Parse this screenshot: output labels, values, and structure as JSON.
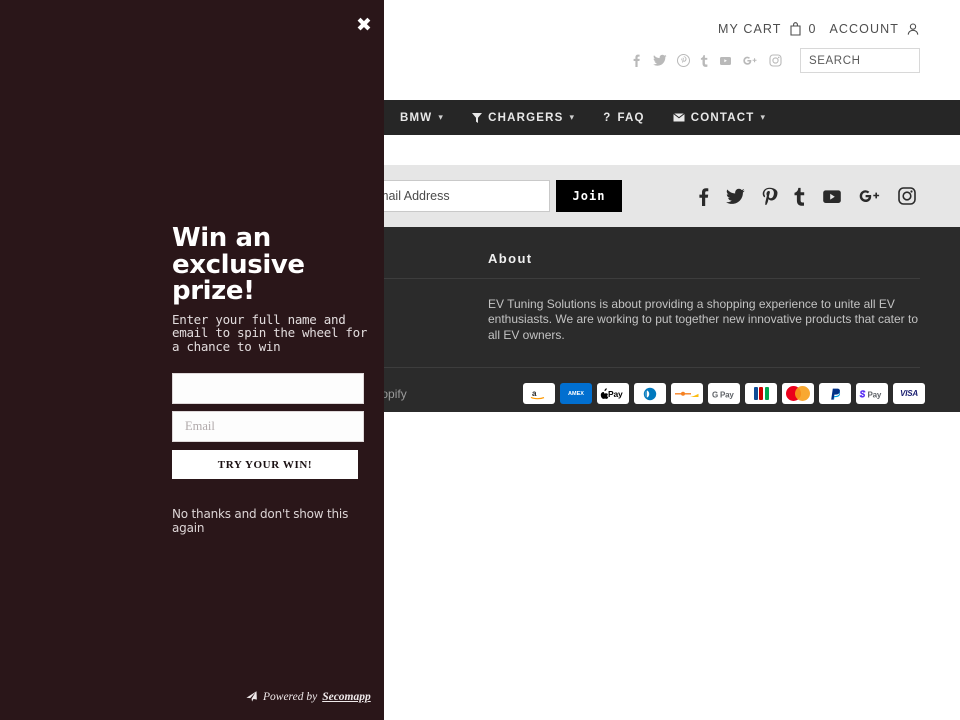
{
  "header": {
    "cart_label": "MY CART",
    "cart_count": "0",
    "cart_icon": "shopping-bag-icon",
    "account_label": "ACCOUNT",
    "account_icon": "user-icon",
    "social": [
      {
        "name": "facebook-icon",
        "glyph": "f"
      },
      {
        "name": "twitter-icon",
        "glyph": "t"
      },
      {
        "name": "pinterest-icon",
        "glyph": "p"
      },
      {
        "name": "tumblr-icon",
        "glyph": "t"
      },
      {
        "name": "youtube-icon",
        "glyph": "y"
      },
      {
        "name": "google-plus-icon",
        "glyph": "G+"
      },
      {
        "name": "instagram-icon",
        "glyph": "i"
      }
    ],
    "search_placeholder": "SEARCH",
    "search_value": ""
  },
  "nav": {
    "items": [
      {
        "label": "BMW",
        "icon": "",
        "caret": true
      },
      {
        "label": "CHARGERS",
        "icon": "filter-icon",
        "caret": true
      },
      {
        "label": "FAQ",
        "icon": "question-mark-icon",
        "caret": false
      },
      {
        "label": "CONTACT",
        "icon": "envelope-icon",
        "caret": true
      }
    ]
  },
  "newsletter": {
    "email_placeholder": "Your Email Address",
    "email_value": "",
    "join_label": "Join",
    "social": [
      {
        "name": "facebook-icon"
      },
      {
        "name": "twitter-icon"
      },
      {
        "name": "pinterest-icon"
      },
      {
        "name": "tumblr-icon"
      },
      {
        "name": "youtube-icon"
      },
      {
        "name": "google-plus-icon"
      },
      {
        "name": "instagram-icon"
      }
    ]
  },
  "footer": {
    "about_heading": "About",
    "about_text": "EV Tuning Solutions is about providing a shopping experience to unite all EV enthusiasts. We are working to put together new innovative products that cater to all EV owners.",
    "shopify_credit": "Powered by Shopify",
    "payments": [
      {
        "name": "amazon-pay-icon",
        "label": "amazon"
      },
      {
        "name": "amex-icon",
        "label": "AMEX"
      },
      {
        "name": "apple-pay-icon",
        "label": "Pay"
      },
      {
        "name": "diners-club-icon",
        "label": "DC"
      },
      {
        "name": "discover-icon",
        "label": "DISCOVER"
      },
      {
        "name": "google-pay-icon",
        "label": "G Pay"
      },
      {
        "name": "jcb-icon",
        "label": "JCB"
      },
      {
        "name": "mastercard-icon",
        "label": "MC"
      },
      {
        "name": "paypal-icon",
        "label": "PayPal"
      },
      {
        "name": "shop-pay-icon",
        "label": "Pay"
      },
      {
        "name": "visa-icon",
        "label": "VISA"
      }
    ]
  },
  "modal": {
    "close_label": "✖",
    "title": "Win an exclusive prize!",
    "subtitle": "Enter your full name and email to spin the wheel for a chance to win",
    "name_placeholder": "",
    "name_value": "",
    "email_placeholder": "Email",
    "email_value": "",
    "submit_label": "TRY YOUR WIN!",
    "decline_label": "No thanks and don't show this again",
    "credit_prefix": "Powered by",
    "credit_brand": "Secomapp",
    "background_color": "#2a1619"
  }
}
